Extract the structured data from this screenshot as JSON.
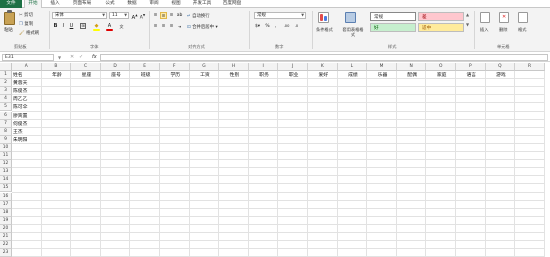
{
  "menu": {
    "file": "文件",
    "tabs": [
      "开始",
      "插入",
      "页面布局",
      "公式",
      "数据",
      "审阅",
      "视图",
      "开发工具",
      "百度网盘"
    ]
  },
  "ribbon": {
    "clipboard": {
      "paste": "粘贴",
      "cut": "剪切",
      "copy": "复制",
      "format_painter": "格式刷",
      "group": "剪贴板"
    },
    "font": {
      "name": "宋体",
      "size": "11",
      "group": "字体"
    },
    "alignment": {
      "wrap": "自动换行",
      "merge": "合并后居中",
      "group": "对齐方式"
    },
    "number": {
      "format": "常规",
      "group": "数字"
    },
    "styles": {
      "conditional": "条件格式",
      "table": "套用表格格式",
      "normal": "常规",
      "bad": "差",
      "good": "好",
      "neutral": "适中",
      "group": "样式"
    },
    "cells": {
      "insert": "插入",
      "delete": "删除",
      "format": "格式",
      "group": "单元格"
    }
  },
  "formula_bar": {
    "name_box": "E31",
    "fx": "fx",
    "value": ""
  },
  "sheet": {
    "columns": [
      "A",
      "B",
      "C",
      "D",
      "E",
      "F",
      "G",
      "H",
      "I",
      "J",
      "K",
      "L",
      "M",
      "N",
      "O",
      "P",
      "Q",
      "R"
    ],
    "rows": [
      "1",
      "2",
      "3",
      "4",
      "5",
      "6",
      "7",
      "8",
      "9",
      "10",
      "11",
      "12",
      "13",
      "14",
      "15",
      "16",
      "17",
      "18",
      "19",
      "20",
      "21",
      "22",
      "23"
    ],
    "headers": [
      "姓名",
      "年龄",
      "星座",
      "座号",
      "班级",
      "学历",
      "工资",
      "性别",
      "职务",
      "职业",
      "爱好",
      "成绩",
      "乐器",
      "配偶",
      "家庭",
      "语言",
      "游戏"
    ],
    "names": [
      "黄蓉天",
      "陈俊杰",
      "周乙乙",
      "陈可伞",
      "廖宾置",
      "何俊杰",
      "王杰",
      "朱明阳"
    ]
  },
  "colors": {
    "accent": "#1e7145",
    "bad_fill": "#ffc7ce",
    "good_fill": "#c6efce",
    "neutral_fill": "#ffeb9c"
  }
}
